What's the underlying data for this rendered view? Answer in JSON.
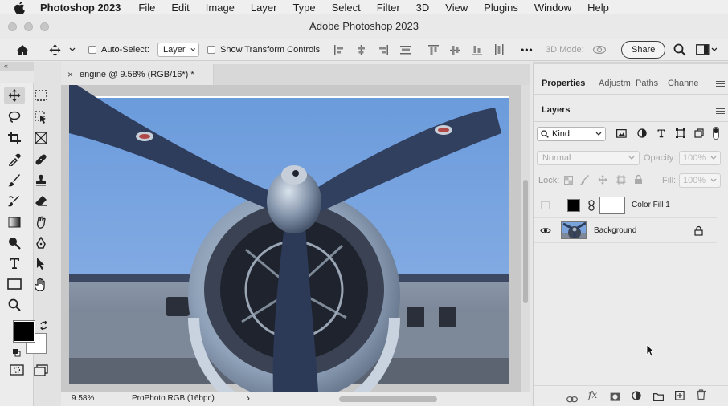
{
  "menubar": {
    "app_name": "Photoshop 2023",
    "items": [
      "File",
      "Edit",
      "Image",
      "Layer",
      "Type",
      "Select",
      "Filter",
      "3D",
      "View",
      "Plugins",
      "Window",
      "Help"
    ]
  },
  "window": {
    "title": "Adobe Photoshop 2023"
  },
  "options_bar": {
    "auto_select_label": "Auto-Select:",
    "auto_select_value": "Layer",
    "show_transform_label": "Show Transform Controls",
    "more_label": "•••",
    "mode_3d_label": "3D Mode:",
    "share_label": "Share"
  },
  "document": {
    "tab_title": "engine @ 9.58% (RGB/16*) *",
    "zoom": "9.58%",
    "color_profile": "ProPhoto RGB  (16bpc)",
    "status_chevron": "›"
  },
  "panels": {
    "tabs": [
      "Properties",
      "Adjustm",
      "Paths",
      "Channe"
    ],
    "layers_tab": "Layers",
    "filter_kind": "Kind",
    "blend_mode": "Normal",
    "opacity_label": "Opacity:",
    "opacity_value": "100%",
    "lock_label": "Lock:",
    "fill_label": "Fill:",
    "fill_value": "100%",
    "layers": [
      {
        "name": "Color Fill 1",
        "visible": false
      },
      {
        "name": "Background",
        "visible": true,
        "locked": true
      }
    ]
  },
  "colors": {
    "foreground": "#000000",
    "background": "#ffffff",
    "sky": "#6f9fdd",
    "propeller": "#2f3d5c"
  },
  "icons": {
    "apple": "apple-logo",
    "home": "home-icon",
    "move": "move-icon",
    "search": "search-icon",
    "layout": "workspace-icon"
  }
}
